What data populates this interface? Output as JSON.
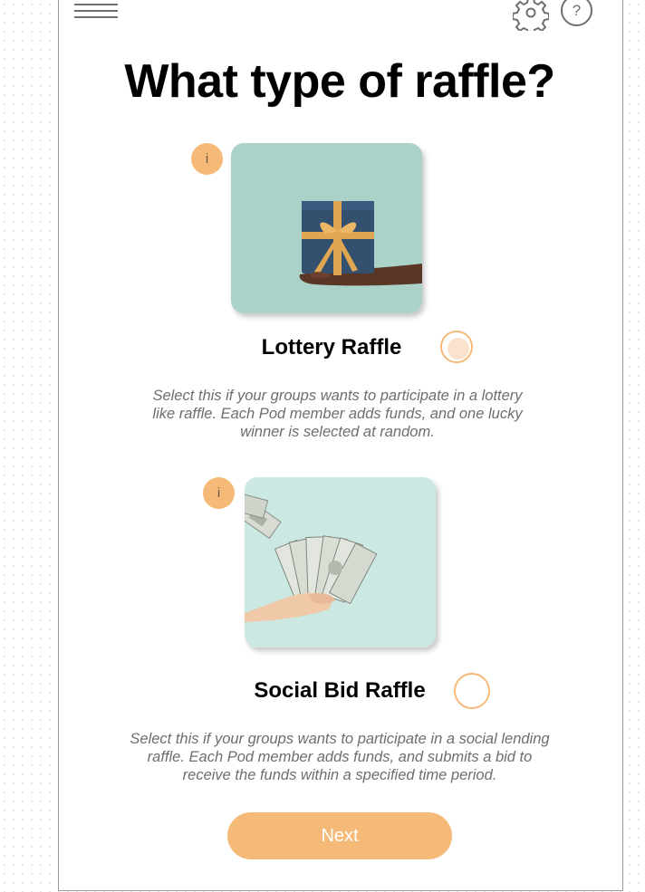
{
  "header": {
    "menu_icon": "menu-icon",
    "settings_icon": "gear-icon",
    "help_icon": "help-icon",
    "help_glyph": "?"
  },
  "page": {
    "title": "What type of raffle?"
  },
  "options": [
    {
      "info_glyph": "i",
      "image_icon": "gift-box-in-hand-image",
      "label": "Lottery Raffle",
      "selected": true,
      "description": "Select this if your groups wants to participate in a lottery like raffle. Each Pod member adds funds, and one lucky winner is selected at random."
    },
    {
      "info_glyph": "i",
      "image_icon": "cash-in-hand-image",
      "label": "Social Bid Raffle",
      "selected": false,
      "description": "Select this if your groups wants to participate in a social lending raffle. Each Pod member adds funds, and submits a bid to receive the funds within a specified time period."
    }
  ],
  "footer": {
    "next_label": "Next"
  },
  "colors": {
    "accent": "#f5b978",
    "card1_bg": "#aad2c9",
    "card2_bg": "#cbe8e3",
    "description_text": "#6e6e6e"
  }
}
